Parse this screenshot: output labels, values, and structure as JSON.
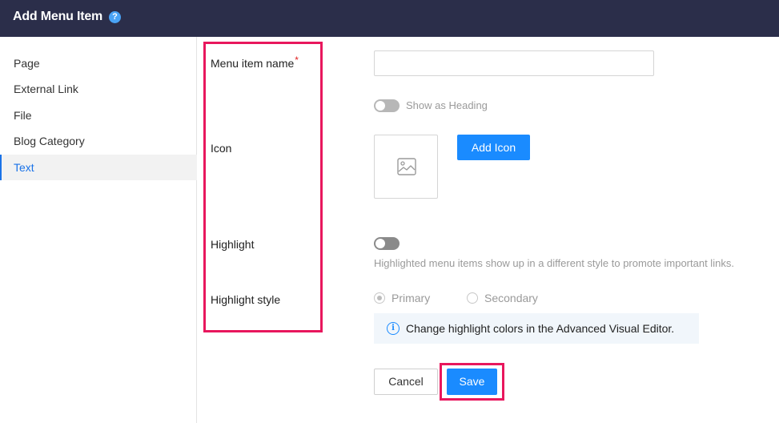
{
  "header": {
    "title": "Add Menu Item",
    "help_glyph": "?"
  },
  "sidebar": {
    "items": [
      {
        "label": "Page",
        "active": false
      },
      {
        "label": "External Link",
        "active": false
      },
      {
        "label": "File",
        "active": false
      },
      {
        "label": "Blog Category",
        "active": false
      },
      {
        "label": "Text",
        "active": true
      }
    ]
  },
  "form": {
    "menu_item_name_label": "Menu item name",
    "required_mark": "*",
    "menu_item_name_value": "",
    "show_as_heading_label": "Show as Heading",
    "show_as_heading_on": false,
    "icon_label": "Icon",
    "add_icon_button": "Add Icon",
    "highlight_label": "Highlight",
    "highlight_on": false,
    "highlight_help": "Highlighted menu items show up in a different style to promote important links.",
    "highlight_style_label": "Highlight style",
    "highlight_style_options": [
      "Primary",
      "Secondary"
    ],
    "highlight_style_selected": "Primary",
    "info_glyph": "i",
    "info_text": "Change highlight colors in the Advanced Visual Editor."
  },
  "actions": {
    "cancel_label": "Cancel",
    "save_label": "Save"
  },
  "colors": {
    "header_bg": "#2b2e4a",
    "primary_button": "#1a8bff",
    "active_nav": "#1a73e8",
    "annotation_box": "#e8175d",
    "required": "#e02020"
  }
}
